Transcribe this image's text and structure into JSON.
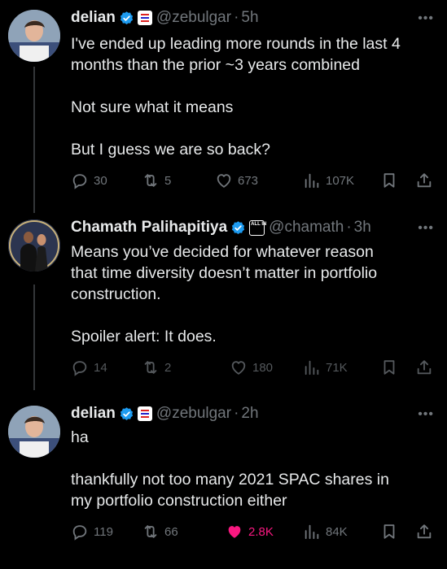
{
  "tweets": [
    {
      "name": "delian",
      "handle": "@zebulgar",
      "dot": "·",
      "time": "5h",
      "lines": [
        "I've ended up leading more rounds in the last 4",
        "months than the prior ~3 years combined",
        "",
        "Not sure what it means",
        "",
        "But I guess we are so back?"
      ],
      "replies": "30",
      "retweets": "5",
      "likes": "673",
      "views": "107K"
    },
    {
      "name": "Chamath Palihapitiya",
      "badge_text": "ALL IN",
      "handle": "@chamath",
      "dot": "·",
      "time": "3h",
      "lines": [
        "Means you’ve decided for whatever reason",
        "that time diversity doesn’t matter in portfolio",
        "construction.",
        "",
        "Spoiler alert: It does."
      ],
      "replies": "14",
      "retweets": "2",
      "likes": "180",
      "views": "71K"
    },
    {
      "name": "delian",
      "handle": "@zebulgar",
      "dot": "·",
      "time": "2h",
      "lines": [
        "ha",
        "",
        "thankfully not too many 2021 SPAC shares in",
        "my portfolio construction either"
      ],
      "replies": "119",
      "retweets": "66",
      "likes": "2.8K",
      "views": "84K"
    }
  ],
  "more_label": "•••",
  "colors": {
    "background": "#000000",
    "text": "#e7e9ea",
    "muted": "#71767b",
    "verified": "#1d9bf0",
    "like": "#f91880"
  },
  "icons": [
    "reply-icon",
    "retweet-icon",
    "like-icon",
    "views-icon",
    "bookmark-icon",
    "share-icon",
    "verified-icon",
    "more-icon"
  ]
}
